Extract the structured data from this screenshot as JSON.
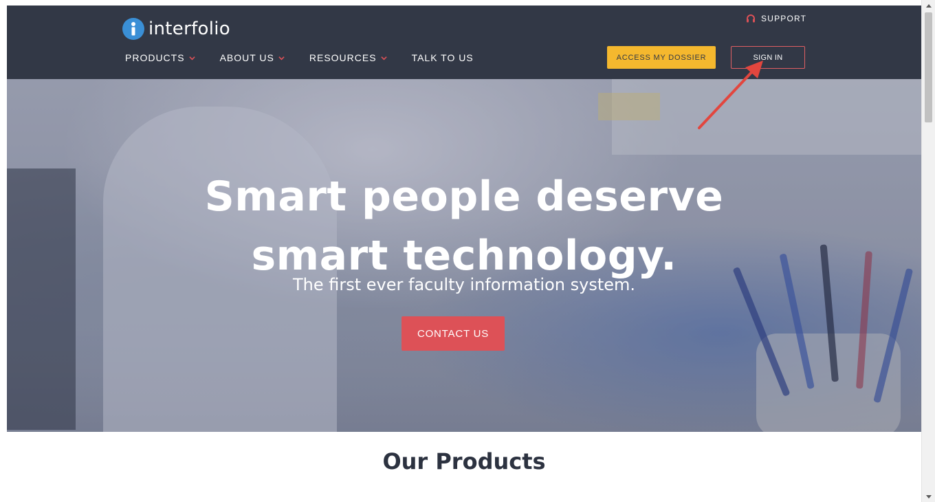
{
  "header": {
    "logo_text": "interfolio",
    "support_label": "SUPPORT",
    "nav": [
      {
        "label": "PRODUCTS",
        "has_dropdown": true
      },
      {
        "label": "ABOUT US",
        "has_dropdown": true
      },
      {
        "label": "RESOURCES",
        "has_dropdown": true
      },
      {
        "label": "TALK TO US",
        "has_dropdown": false
      }
    ],
    "access_button": "ACCESS MY DOSSIER",
    "signin_button": "SIGN IN"
  },
  "hero": {
    "title": "Smart people deserve smart technology.",
    "subtitle": "The first ever faculty information system.",
    "cta": "CONTACT US"
  },
  "products": {
    "heading": "Our Products"
  },
  "icons": {
    "logo": "info-icon",
    "support": "headset-icon",
    "dropdown": "chevron-down-icon",
    "annotation": "arrow-pointer-icon"
  },
  "colors": {
    "header_bg": "#323846",
    "accent_red": "#dd5157",
    "accent_yellow": "#f5b82e",
    "logo_blue": "#3a8fd6",
    "heading_text": "#2c3240"
  }
}
